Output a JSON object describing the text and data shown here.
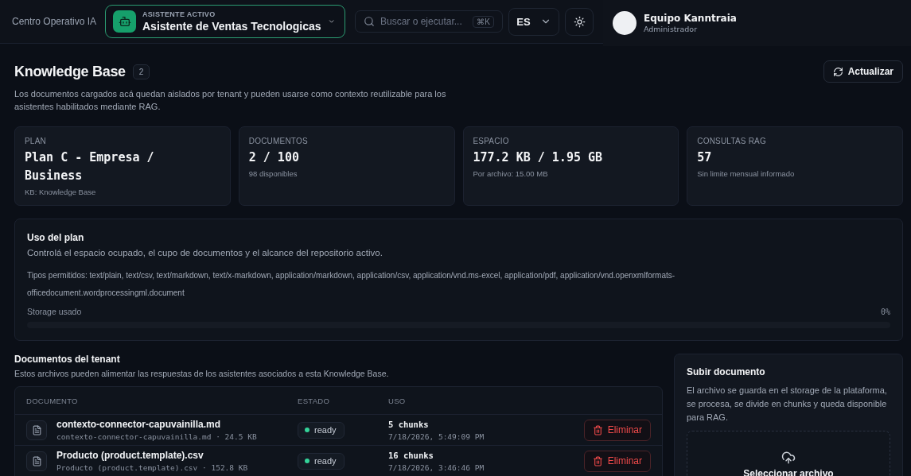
{
  "topbar": {
    "title": "Centro Operativo IA",
    "assistant": {
      "label": "ASISTENTE ACTIVO",
      "name": "Asistente de Ventas Tecnologicas"
    },
    "search": {
      "placeholder": "Buscar o ejecutar...",
      "shortcut": "⌘K"
    },
    "language": "ES",
    "user": {
      "name": "Equipo Kanntraia",
      "role": "Administrador"
    }
  },
  "header": {
    "title": "Knowledge Base",
    "count": "2",
    "description": "Los documentos cargados acá quedan aislados por tenant y pueden usarse como contexto reutilizable para los asistentes habilitados mediante RAG.",
    "refresh_button": "Actualizar"
  },
  "stats": [
    {
      "label": "PLAN",
      "value": "Plan C - Empresa / Business",
      "note": "KB: Knowledge Base"
    },
    {
      "label": "DOCUMENTOS",
      "value": "2 / 100",
      "note": "98 disponibles"
    },
    {
      "label": "ESPACIO",
      "value": "177.2 KB / 1.95 GB",
      "note": "Por archivo: 15.00 MB"
    },
    {
      "label": "CONSULTAS RAG",
      "value": "57",
      "note": "Sin limite mensual informado"
    }
  ],
  "plan_usage": {
    "title": "Uso del plan",
    "subtitle": "Controlá el espacio ocupado, el cupo de documentos y el alcance del repositorio activo.",
    "allowed_types": "Tipos permitidos: text/plain, text/csv, text/markdown, text/x-markdown, application/markdown, application/csv, application/vnd.ms-excel, application/pdf, application/vnd.openxmlformats-officedocument.wordprocessingml.document",
    "storage_label": "Storage usado",
    "storage_reading": "0%",
    "level": 0
  },
  "documents": {
    "title": "Documentos del tenant",
    "subtitle": "Estos archivos pueden alimentar las respuestas de los asistentes asociados a esta Knowledge Base.",
    "columns": [
      "DOCUMENTO",
      "ESTADO",
      "USO"
    ],
    "rows": [
      {
        "name": "contexto-connector-capuvainilla.md",
        "file_info": "contexto-connector-capuvainilla.md · 24.5 KB",
        "status": {
          "label": "ready",
          "color": "#34d399"
        },
        "chunks": "5 chunks",
        "date": "7/18/2026, 5:49:09 PM",
        "delete_button": "Eliminar"
      },
      {
        "name": "Producto (product.template).csv",
        "file_info": "Producto (product.template).csv · 152.8 KB",
        "status": {
          "label": "ready",
          "color": "#34d399"
        },
        "chunks": "16 chunks",
        "date": "7/18/2026, 3:46:46 PM",
        "delete_button": "Eliminar"
      }
    ]
  },
  "upload": {
    "title": "Subir documento",
    "description": "El archivo se guarda en el storage de la plataforma, se procesa, se divide en chunks y queda disponible para RAG.",
    "button": "Seleccionar archivo"
  }
}
